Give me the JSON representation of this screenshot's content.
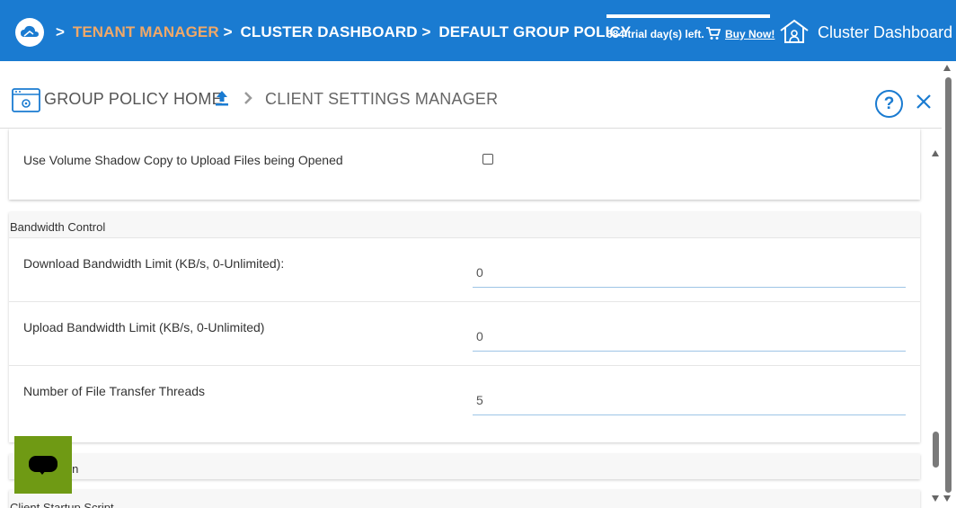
{
  "topbar": {
    "breadcrumb_sep": ">",
    "tenant_manager": "TENANT MANAGER",
    "cluster_dashboard": "CLUSTER DASHBOARD",
    "default_group_policy": "DEFAULT GROUP POLICY",
    "trial_text": "684 trial day(s) left.",
    "buy_now": "Buy Now!",
    "title": "Cluster Dashboard",
    "accent_color": "#f0a868",
    "bar_color": "#1a7bd1"
  },
  "header": {
    "group_policy_home": "GROUP POLICY HOME",
    "client_settings_manager": "CLIENT SETTINGS MANAGER",
    "help_glyph": "?"
  },
  "settings": {
    "volume_shadow_label": "Use Volume Shadow Copy to Upload Files being Opened",
    "volume_shadow_checked": false
  },
  "bandwidth": {
    "title": "Bandwidth Control",
    "fields": [
      {
        "label": "Download Bandwidth Limit (KB/s, 0-Unlimited):",
        "value": "0"
      },
      {
        "label": "Upload Bandwidth Limit (KB/s, 0-Unlimited)",
        "value": "0"
      },
      {
        "label": "Number of File Transfer Threads",
        "value": "5"
      }
    ]
  },
  "sections": {
    "next_partial": "gin",
    "last_partial": "Client Startup Script"
  },
  "icons": {
    "logo": "cloud-logo-icon",
    "cart": "cart-icon",
    "home": "home-icon",
    "group_policy": "group-policy-icon",
    "upload": "upload-icon",
    "chevron": "chevron-right-icon",
    "help": "help-icon",
    "close": "close-icon",
    "chat": "chat-icon"
  }
}
